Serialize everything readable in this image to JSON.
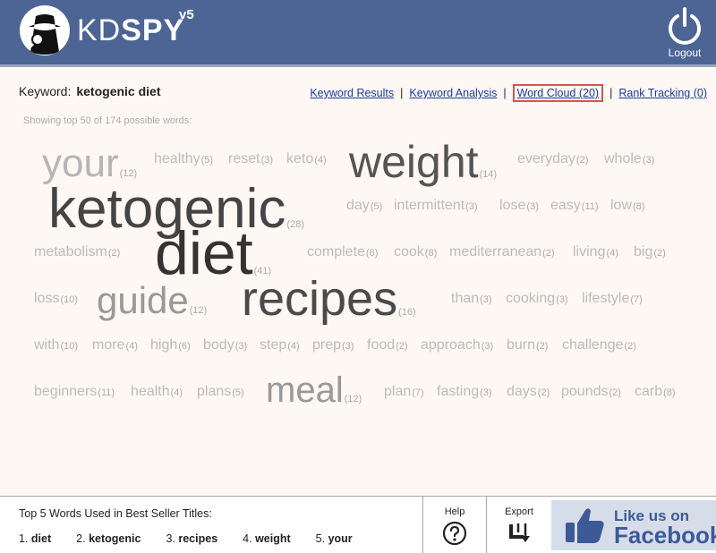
{
  "app": {
    "logo_kd": "KD",
    "logo_spy": "SPY",
    "version": "v5",
    "logout_label": "Logout"
  },
  "keyword": {
    "label": "Keyword:",
    "value": "ketogenic diet"
  },
  "nav": {
    "keyword_results": "Keyword Results",
    "keyword_analysis": "Keyword Analysis",
    "word_cloud": "Word Cloud (20)",
    "rank_tracking": "Rank Tracking (0)",
    "separator": "|"
  },
  "showing": "Showing top 50 of 174 possible words:",
  "cloud": {
    "words": [
      {
        "word": "your",
        "count": "(12)"
      },
      {
        "word": "healthy",
        "count": "(5)"
      },
      {
        "word": "reset",
        "count": "(3)"
      },
      {
        "word": "keto",
        "count": "(4)"
      },
      {
        "word": "weight",
        "count": "(14)"
      },
      {
        "word": "everyday",
        "count": "(2)"
      },
      {
        "word": "whole",
        "count": "(3)"
      },
      {
        "word": "ketogenic",
        "count": "(28)"
      },
      {
        "word": "day",
        "count": "(5)"
      },
      {
        "word": "intermittent",
        "count": "(3)"
      },
      {
        "word": "lose",
        "count": "(3)"
      },
      {
        "word": "easy",
        "count": "(11)"
      },
      {
        "word": "low",
        "count": "(8)"
      },
      {
        "word": "metabolism",
        "count": "(2)"
      },
      {
        "word": "diet",
        "count": "(41)"
      },
      {
        "word": "complete",
        "count": "(6)"
      },
      {
        "word": "cook",
        "count": "(8)"
      },
      {
        "word": "mediterranean",
        "count": "(2)"
      },
      {
        "word": "living",
        "count": "(4)"
      },
      {
        "word": "big",
        "count": "(2)"
      },
      {
        "word": "loss",
        "count": "(10)"
      },
      {
        "word": "guide",
        "count": "(12)"
      },
      {
        "word": "recipes",
        "count": "(16)"
      },
      {
        "word": "than",
        "count": "(3)"
      },
      {
        "word": "cooking",
        "count": "(3)"
      },
      {
        "word": "lifestyle",
        "count": "(7)"
      },
      {
        "word": "with",
        "count": "(10)"
      },
      {
        "word": "more",
        "count": "(4)"
      },
      {
        "word": "high",
        "count": "(6)"
      },
      {
        "word": "body",
        "count": "(3)"
      },
      {
        "word": "step",
        "count": "(4)"
      },
      {
        "word": "prep",
        "count": "(3)"
      },
      {
        "word": "food",
        "count": "(2)"
      },
      {
        "word": "approach",
        "count": "(3)"
      },
      {
        "word": "burn",
        "count": "(2)"
      },
      {
        "word": "challenge",
        "count": "(2)"
      },
      {
        "word": "beginners",
        "count": "(11)"
      },
      {
        "word": "health",
        "count": "(4)"
      },
      {
        "word": "plans",
        "count": "(5)"
      },
      {
        "word": "meal",
        "count": "(12)"
      },
      {
        "word": "plan",
        "count": "(7)"
      },
      {
        "word": "fasting",
        "count": "(3)"
      },
      {
        "word": "days",
        "count": "(2)"
      },
      {
        "word": "pounds",
        "count": "(2)"
      },
      {
        "word": "carb",
        "count": "(8)"
      }
    ]
  },
  "footer": {
    "top5_label": "Top 5 Words Used in Best Seller Titles:",
    "top5": [
      {
        "rank": "1.",
        "word": "diet"
      },
      {
        "rank": "2.",
        "word": "ketogenic"
      },
      {
        "rank": "3.",
        "word": "recipes"
      },
      {
        "rank": "4.",
        "word": "weight"
      },
      {
        "rank": "5.",
        "word": "your"
      }
    ],
    "help_label": "Help",
    "export_label": "Export",
    "fb_like": "Like us on",
    "fb_name": "Facebook"
  },
  "colors": {
    "header_bg": "#4c6595",
    "link": "#1a3aa8",
    "active_border": "#d9534f",
    "facebook": "#3d5a98"
  }
}
